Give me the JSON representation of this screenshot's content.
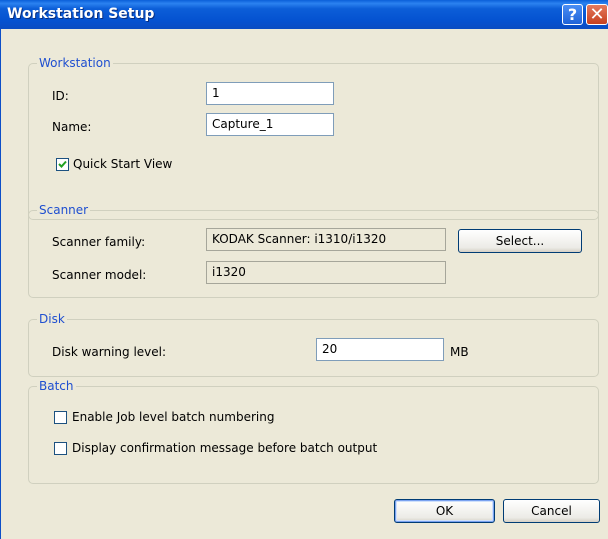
{
  "window": {
    "title": "Workstation Setup",
    "help_glyph": "?",
    "close_glyph": "✕"
  },
  "workstation": {
    "legend": "Workstation",
    "id_label": "ID:",
    "id_value": "1",
    "name_label": "Name:",
    "name_value": "Capture_1",
    "quick_start_label": "Quick Start View",
    "quick_start_checked": true
  },
  "scanner": {
    "legend": "Scanner",
    "family_label": "Scanner family:",
    "family_value": "KODAK Scanner: i1310/i1320",
    "model_label": "Scanner model:",
    "model_value": "i1320",
    "select_label": "Select..."
  },
  "disk": {
    "legend": "Disk",
    "warning_label": "Disk warning level:",
    "warning_value": "20",
    "unit": "MB"
  },
  "batch": {
    "legend": "Batch",
    "job_numbering_label": "Enable Job level batch numbering",
    "job_numbering_checked": false,
    "confirm_label": "Display confirmation message before batch output",
    "confirm_checked": false
  },
  "buttons": {
    "ok": "OK",
    "cancel": "Cancel"
  },
  "icons": {
    "help": "help-icon",
    "close": "close-icon",
    "check": "checkmark-icon"
  },
  "colors": {
    "title_bar": "#0a56d0",
    "legend": "#1f4fd0",
    "dialog": "#ece9d8",
    "close": "#c7401f"
  }
}
